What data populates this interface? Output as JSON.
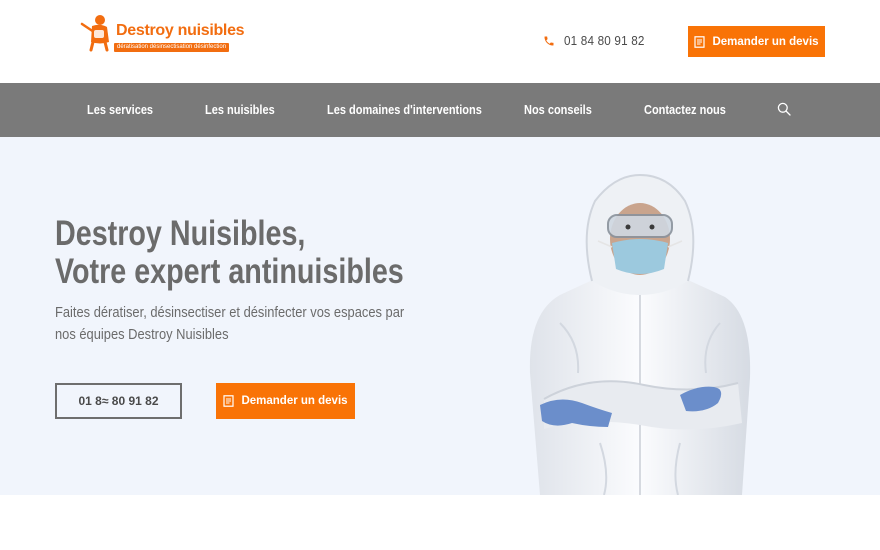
{
  "header": {
    "logo": {
      "title": "Destroy nuisibles",
      "tagline": "dératisation désinsectisation désinfection"
    },
    "phone": "01 84 80 91 82",
    "quote_button": "Demander un devis"
  },
  "nav": {
    "items": [
      {
        "label": "Les services"
      },
      {
        "label": "Les nuisibles"
      },
      {
        "label": "Les domaines d'interventions"
      },
      {
        "label": "Nos conseils"
      },
      {
        "label": "Contactez nous"
      }
    ]
  },
  "hero": {
    "title_line1": "Destroy Nuisibles,",
    "title_line2": "Votre expert antinuisibles",
    "subtitle": "Faites dératiser, désinsectiser et désinfecter vos espaces par nos équipes Destroy Nuisibles",
    "phone_button": "01 8≈ 80 91 82",
    "quote_button": "Demander un devis"
  },
  "colors": {
    "accent": "#f97306",
    "nav_background": "#7a7a7a",
    "hero_background": "#f1f5fc",
    "text": "#6b6b6b"
  },
  "icons": {
    "phone": "phone-icon",
    "document": "document-icon",
    "search": "search-icon",
    "logo": "exterminator-logo-icon"
  }
}
